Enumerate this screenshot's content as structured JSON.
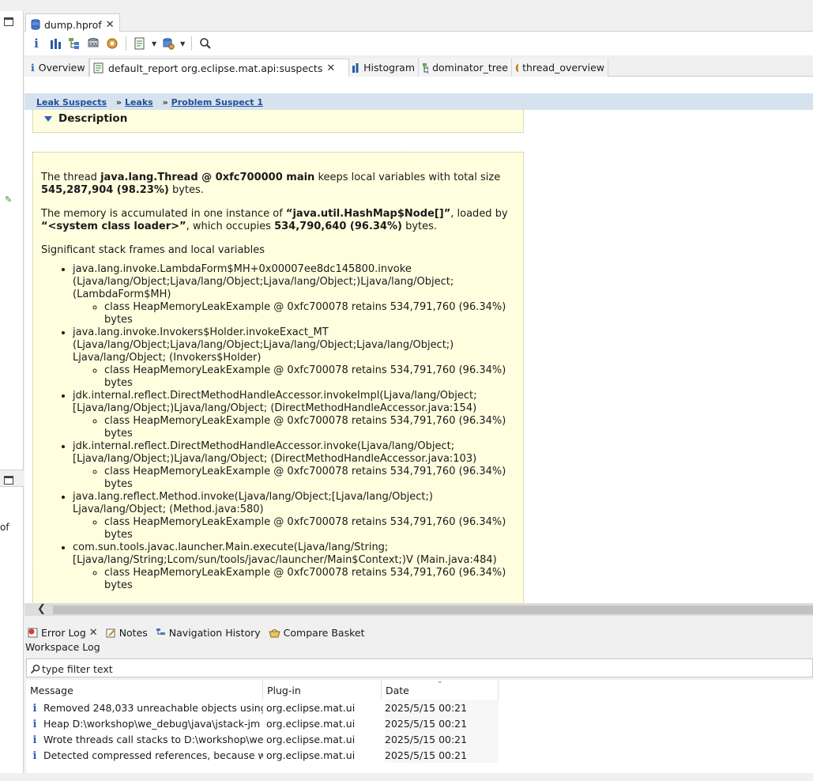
{
  "editor_tab": {
    "title": "dump.hprof"
  },
  "toolbar": {
    "icons": [
      "info-icon",
      "histogram-icon",
      "dominator-tree-icon",
      "oql-icon",
      "thread-overview-icon",
      "reports-icon",
      "heap-dump-icon",
      "search-icon"
    ]
  },
  "report_tabs": [
    {
      "label": "Overview"
    },
    {
      "label": "default_report org.eclipse.mat.api:suspects"
    },
    {
      "label": "Histogram"
    },
    {
      "label": "dominator_tree"
    },
    {
      "label": "thread_overview"
    }
  ],
  "breadcrumb": {
    "items": [
      "Leak Suspects",
      "Leaks",
      "Problem Suspect 1"
    ],
    "separator": "»"
  },
  "description": {
    "heading": "Description",
    "p1": {
      "pre": "The thread ",
      "thread": "java.lang.Thread @ 0xfc700000 main",
      "mid": " keeps local variables with total size ",
      "size": "545,287,904 (98.23%)",
      "post": " bytes."
    },
    "p2": {
      "pre": "The memory is accumulated in one instance of ",
      "cls": "“java.util.HashMap$Node[]”",
      "mid": ", loaded by ",
      "loader": "“<system class loader>”",
      "mid2": ", which occupies ",
      "size": "534,790,640 (96.34%)",
      "post": " bytes."
    },
    "p3": "Significant stack frames and local variables",
    "frames": [
      {
        "frame": "java.lang.invoke.LambdaForm$MH+0x00007ee8dc145800.invoke (Ljava/lang/Object;Ljava/lang/Object;Ljava/lang/Object;)Ljava/lang/Object; (LambdaForm$MH)",
        "local": "class HeapMemoryLeakExample @ 0xfc700078 retains 534,791,760 (96.34%) bytes"
      },
      {
        "frame": "java.lang.invoke.Invokers$Holder.invokeExact_MT (Ljava/lang/Object;Ljava/lang/Object;Ljava/lang/Object;Ljava/lang/Object;) Ljava/lang/Object; (Invokers$Holder)",
        "local": "class HeapMemoryLeakExample @ 0xfc700078 retains 534,791,760 (96.34%) bytes"
      },
      {
        "frame": "jdk.internal.reflect.DirectMethodHandleAccessor.invokeImpl(Ljava/lang/Object;[Ljava/lang/Object;)Ljava/lang/Object; (DirectMethodHandleAccessor.java:154)",
        "local": "class HeapMemoryLeakExample @ 0xfc700078 retains 534,791,760 (96.34%) bytes"
      },
      {
        "frame": "jdk.internal.reflect.DirectMethodHandleAccessor.invoke(Ljava/lang/Object;[Ljava/lang/Object;)Ljava/lang/Object; (DirectMethodHandleAccessor.java:103)",
        "local": "class HeapMemoryLeakExample @ 0xfc700078 retains 534,791,760 (96.34%) bytes"
      },
      {
        "frame": "java.lang.reflect.Method.invoke(Ljava/lang/Object;[Ljava/lang/Object;) Ljava/lang/Object; (Method.java:580)",
        "local": "class HeapMemoryLeakExample @ 0xfc700078 retains 534,791,760 (96.34%) bytes"
      },
      {
        "frame": "com.sun.tools.javac.launcher.Main.execute(Ljava/lang/String;[Ljava/lang/String;Lcom/sun/tools/javac/launcher/Main$Context;)V (Main.java:484)",
        "local": "class HeapMemoryLeakExample @ 0xfc700078 retains 534,791,760 (96.34%) bytes"
      }
    ]
  },
  "bottom_tabs": [
    {
      "label": "Error Log"
    },
    {
      "label": "Notes"
    },
    {
      "label": "Navigation History"
    },
    {
      "label": "Compare Basket"
    }
  ],
  "workspace_log": "Workspace Log",
  "filter": {
    "placeholder": "type filter text"
  },
  "log_table": {
    "columns": [
      "Message",
      "Plug-in",
      "Date"
    ],
    "rows": [
      {
        "message": "Removed 248,033 unreachable objects using",
        "plugin": "org.eclipse.mat.ui",
        "date": "2025/5/15 00:21"
      },
      {
        "message": "Heap D:\\workshop\\we_debug\\java\\jstack-jm",
        "plugin": "org.eclipse.mat.ui",
        "date": "2025/5/15 00:21"
      },
      {
        "message": "Wrote threads call stacks to D:\\workshop\\we",
        "plugin": "org.eclipse.mat.ui",
        "date": "2025/5/15 00:21"
      },
      {
        "message": "Detected compressed references, because w",
        "plugin": "org.eclipse.mat.ui",
        "date": "2025/5/15 00:21"
      }
    ]
  },
  "left_strip": {
    "fragment": "of"
  },
  "colors": {
    "report_bg": "#ffffe0",
    "breadcrumb_bg": "#d6e3ef",
    "link": "#1f4f9a",
    "info_icon": "#2d5fbf"
  }
}
